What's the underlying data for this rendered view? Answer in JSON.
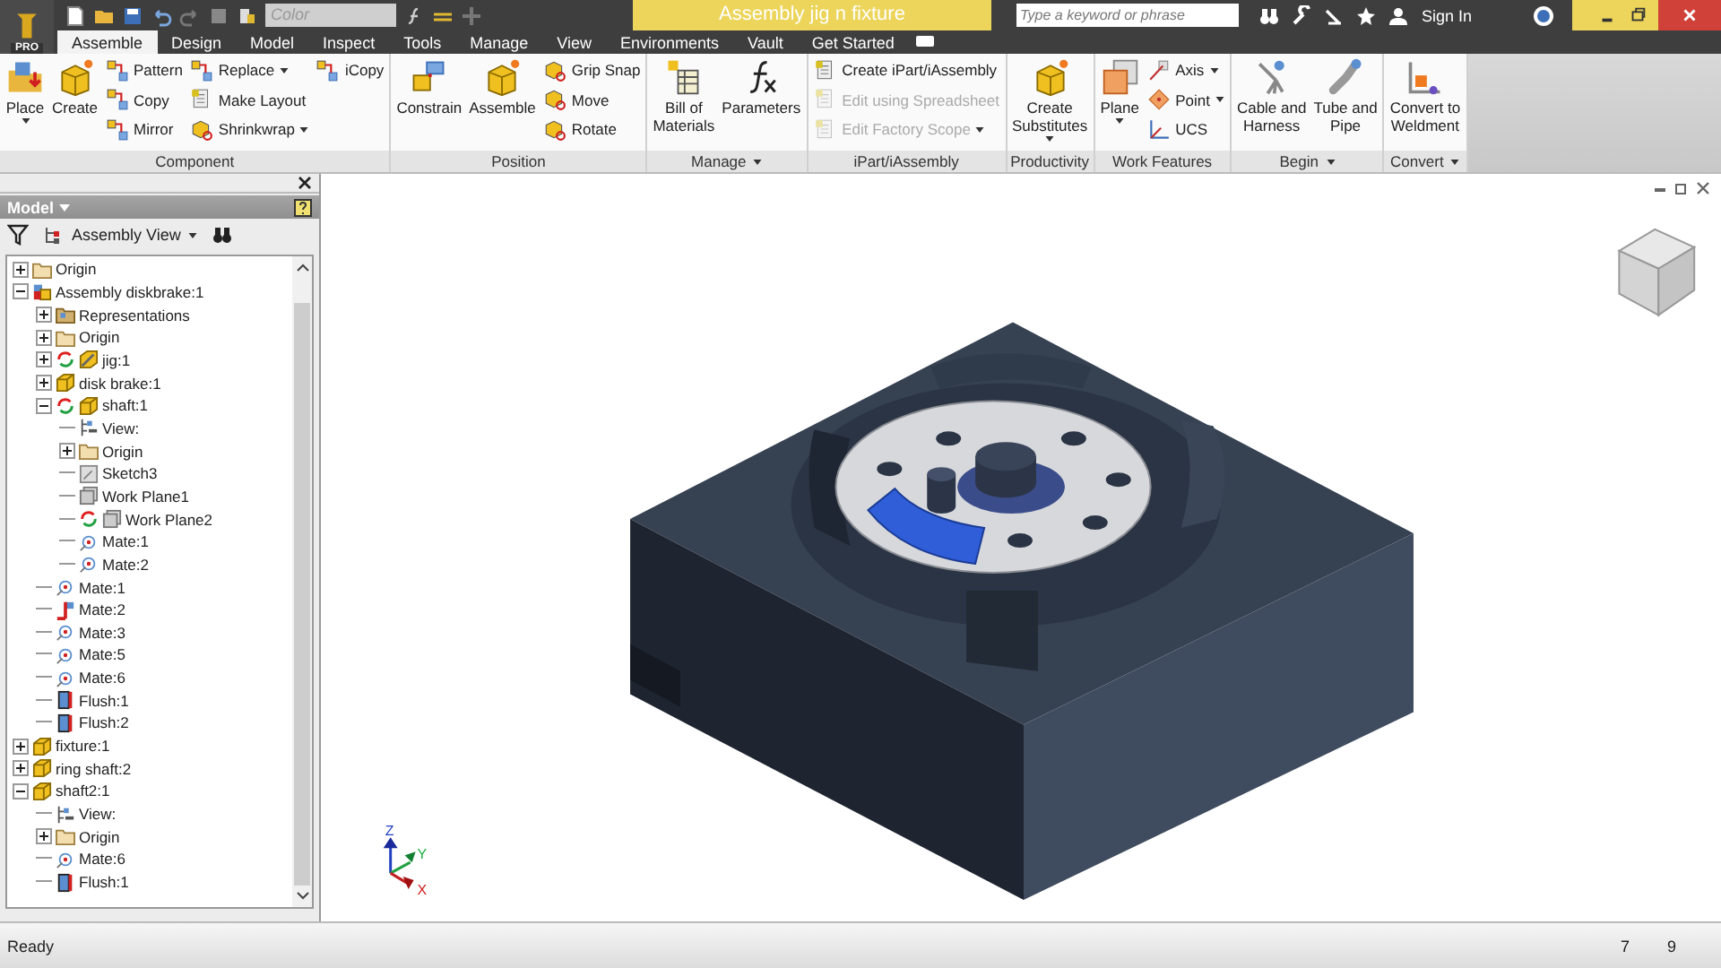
{
  "app_menu": {
    "label": "PRO"
  },
  "quick_access": {
    "style_field": {
      "value": "Color"
    }
  },
  "window": {
    "title": "Assembly jig n fixture"
  },
  "search": {
    "placeholder": "Type a keyword or phrase"
  },
  "account": {
    "label": "Sign In"
  },
  "tabs": [
    {
      "label": "Assemble",
      "selected": true
    },
    {
      "label": "Design",
      "selected": false
    },
    {
      "label": "Model",
      "selected": false
    },
    {
      "label": "Inspect",
      "selected": false
    },
    {
      "label": "Tools",
      "selected": false
    },
    {
      "label": "Manage",
      "selected": false
    },
    {
      "label": "View",
      "selected": false
    },
    {
      "label": "Environments",
      "selected": false
    },
    {
      "label": "Vault",
      "selected": false
    },
    {
      "label": "Get Started",
      "selected": false
    }
  ],
  "ribbon": {
    "panels": [
      {
        "title": "Component",
        "menu": false,
        "groups": [
          {
            "kind": "large",
            "label": "Place",
            "dropdown": true
          },
          {
            "kind": "large",
            "label": "Create",
            "dropdown": false
          },
          {
            "kind": "stack",
            "items": [
              {
                "label": "Pattern",
                "dropdown": false,
                "disabled": false
              },
              {
                "label": "Copy",
                "dropdown": false,
                "disabled": false
              },
              {
                "label": "Mirror",
                "dropdown": false,
                "disabled": false
              }
            ]
          },
          {
            "kind": "stack",
            "items": [
              {
                "label": "Replace",
                "dropdown": true,
                "disabled": false
              },
              {
                "label": "Make Layout",
                "dropdown": false,
                "disabled": false
              },
              {
                "label": "Shrinkwrap",
                "dropdown": true,
                "disabled": false
              }
            ]
          },
          {
            "kind": "stack",
            "items": [
              {
                "label": "iCopy",
                "dropdown": false,
                "disabled": false
              }
            ]
          }
        ]
      },
      {
        "title": "Position",
        "menu": false,
        "groups": [
          {
            "kind": "large",
            "label": "Constrain",
            "dropdown": false
          },
          {
            "kind": "large",
            "label": "Assemble",
            "dropdown": false
          },
          {
            "kind": "stack",
            "items": [
              {
                "label": "Grip Snap",
                "dropdown": false,
                "disabled": false
              },
              {
                "label": "Move",
                "dropdown": false,
                "disabled": false
              },
              {
                "label": "Rotate",
                "dropdown": false,
                "disabled": false
              }
            ]
          }
        ]
      },
      {
        "title": "Manage",
        "menu": true,
        "groups": [
          {
            "kind": "large",
            "label": "Bill of\nMaterials",
            "dropdown": false
          },
          {
            "kind": "large",
            "label": "Parameters",
            "dropdown": false
          }
        ]
      },
      {
        "title": "iPart/iAssembly",
        "menu": false,
        "groups": [
          {
            "kind": "stack",
            "items": [
              {
                "label": "Create iPart/iAssembly",
                "dropdown": false,
                "disabled": false
              },
              {
                "label": "Edit using Spreadsheet",
                "dropdown": false,
                "disabled": true
              },
              {
                "label": "Edit Factory Scope",
                "dropdown": true,
                "disabled": true
              }
            ]
          }
        ]
      },
      {
        "title": "Productivity",
        "menu": false,
        "groups": [
          {
            "kind": "large",
            "label": "Create\nSubstitutes",
            "dropdown": true
          }
        ]
      },
      {
        "title": "Work Features",
        "menu": false,
        "groups": [
          {
            "kind": "large",
            "label": "Plane",
            "dropdown": true
          },
          {
            "kind": "stack",
            "items": [
              {
                "label": "Axis",
                "dropdown": true,
                "disabled": false
              },
              {
                "label": "Point",
                "dropdown": true,
                "disabled": false
              },
              {
                "label": "UCS",
                "dropdown": false,
                "disabled": false
              }
            ]
          }
        ]
      },
      {
        "title": "Begin",
        "menu": true,
        "groups": [
          {
            "kind": "large",
            "label": "Cable and\nHarness",
            "dropdown": false
          },
          {
            "kind": "large",
            "label": "Tube and\nPipe",
            "dropdown": false
          }
        ]
      },
      {
        "title": "Convert",
        "menu": true,
        "groups": [
          {
            "kind": "large",
            "label": "Convert to\nWeldment",
            "dropdown": false
          }
        ]
      }
    ]
  },
  "browser": {
    "title": "Model",
    "view": "Assembly View",
    "tree": [
      {
        "label": "Origin",
        "kind": "folder",
        "adaptive": false,
        "expanded": false
      },
      {
        "label": "Assembly diskbrake:1",
        "kind": "assembly",
        "adaptive": false,
        "expanded": true,
        "children": [
          {
            "label": "Representations",
            "kind": "representations",
            "adaptive": false,
            "expanded": false
          },
          {
            "label": "Origin",
            "kind": "folder",
            "adaptive": false,
            "expanded": false
          },
          {
            "label": "jig:1",
            "kind": "tool-part",
            "adaptive": true,
            "expanded": false
          },
          {
            "label": "disk brake:1",
            "kind": "part",
            "adaptive": false,
            "expanded": false
          },
          {
            "label": "shaft:1",
            "kind": "part",
            "adaptive": true,
            "expanded": true,
            "children": [
              {
                "label": "View:",
                "kind": "view",
                "adaptive": false
              },
              {
                "label": "Origin",
                "kind": "folder",
                "adaptive": false,
                "expanded": false
              },
              {
                "label": "Sketch3",
                "kind": "sketch",
                "adaptive": false
              },
              {
                "label": "Work Plane1",
                "kind": "workplane",
                "adaptive": false
              },
              {
                "label": "Work Plane2",
                "kind": "workplane",
                "adaptive": true
              },
              {
                "label": "Mate:1",
                "kind": "mate",
                "adaptive": false
              },
              {
                "label": "Mate:2",
                "kind": "mate",
                "adaptive": false
              }
            ]
          },
          {
            "label": "Mate:1",
            "kind": "mate",
            "adaptive": false
          },
          {
            "label": "Mate:2",
            "kind": "angle",
            "adaptive": false
          },
          {
            "label": "Mate:3",
            "kind": "mate",
            "adaptive": false
          },
          {
            "label": "Mate:5",
            "kind": "mate",
            "adaptive": false
          },
          {
            "label": "Mate:6",
            "kind": "mate",
            "adaptive": false
          },
          {
            "label": "Flush:1",
            "kind": "flush",
            "adaptive": false
          },
          {
            "label": "Flush:2",
            "kind": "flush",
            "adaptive": false
          }
        ]
      },
      {
        "label": "fixture:1",
        "kind": "part",
        "adaptive": false,
        "expanded": false
      },
      {
        "label": "ring shaft:2",
        "kind": "part",
        "adaptive": false,
        "expanded": false
      },
      {
        "label": "shaft2:1",
        "kind": "part",
        "adaptive": false,
        "expanded": true,
        "children": [
          {
            "label": "View:",
            "kind": "view",
            "adaptive": false
          },
          {
            "label": "Origin",
            "kind": "folder",
            "adaptive": false,
            "expanded": false
          },
          {
            "label": "Mate:6",
            "kind": "mate",
            "adaptive": false
          },
          {
            "label": "Flush:1",
            "kind": "flush",
            "adaptive": false
          }
        ]
      }
    ]
  },
  "viewport": {
    "triad": {
      "z": "Z",
      "y": "Y",
      "x": "X"
    }
  },
  "status_bar": {
    "message": "Ready",
    "fields": [
      "7",
      "9"
    ]
  }
}
